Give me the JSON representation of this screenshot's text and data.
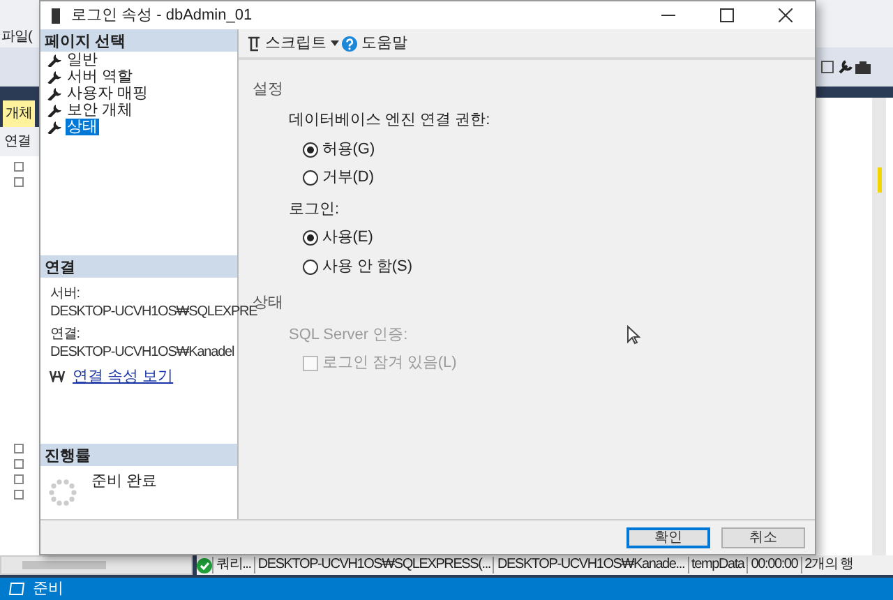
{
  "app": {
    "menu": "파일(",
    "explorer_tab": "개체",
    "explorer_connect": "연결",
    "query_bar": [
      "쿼리...",
      "DESKTOP-UCVH1OS₩SQLEXPRESS(...",
      "DESKTOP-UCVH1OS₩Kanade...",
      "tempData",
      "00:00:00",
      "2개의 행"
    ],
    "status": "준비"
  },
  "dialog": {
    "title": "로그인 속성 - dbAdmin_01",
    "page_select": {
      "header": "페이지 선택",
      "items": [
        {
          "label": "일반",
          "selected": false
        },
        {
          "label": "서버 역할",
          "selected": false
        },
        {
          "label": "사용자 매핑",
          "selected": false
        },
        {
          "label": "보안 개체",
          "selected": false
        },
        {
          "label": "상태",
          "selected": true
        }
      ]
    },
    "connection": {
      "header": "연결",
      "server_label": "서버:",
      "server": "DESKTOP-UCVH1OS₩SQLEXPRE",
      "connection_label": "연결:",
      "connection": "DESKTOP-UCVH1OS₩Kanadel",
      "link": "연결 속성 보기"
    },
    "progress": {
      "header": "진행률",
      "status": "준비 완료"
    },
    "toolbar": {
      "script": "스크립트",
      "help": "도움말"
    },
    "sections": [
      {
        "title": "설정",
        "groups": [
          {
            "label": "데이터베이스 엔진 연결 권한:",
            "disabled": false,
            "options": [
              {
                "kind": "radio",
                "label": "허용(G)",
                "selected": true,
                "disabled": false
              },
              {
                "kind": "radio",
                "label": "거부(D)",
                "selected": false,
                "disabled": false
              }
            ]
          },
          {
            "label": "로그인:",
            "disabled": false,
            "options": [
              {
                "kind": "radio",
                "label": "사용(E)",
                "selected": true,
                "disabled": false
              },
              {
                "kind": "radio",
                "label": "사용 안 함(S)",
                "selected": false,
                "disabled": false
              }
            ]
          }
        ]
      },
      {
        "title": "상태",
        "groups": [
          {
            "label": "SQL Server 인증:",
            "disabled": true,
            "options": [
              {
                "kind": "checkbox",
                "label": "로그인 잠겨 있음(L)",
                "checked": false,
                "disabled": true
              }
            ]
          }
        ]
      }
    ],
    "buttons": [
      {
        "label": "확인",
        "default": true
      },
      {
        "label": "취소",
        "default": false
      }
    ]
  }
}
